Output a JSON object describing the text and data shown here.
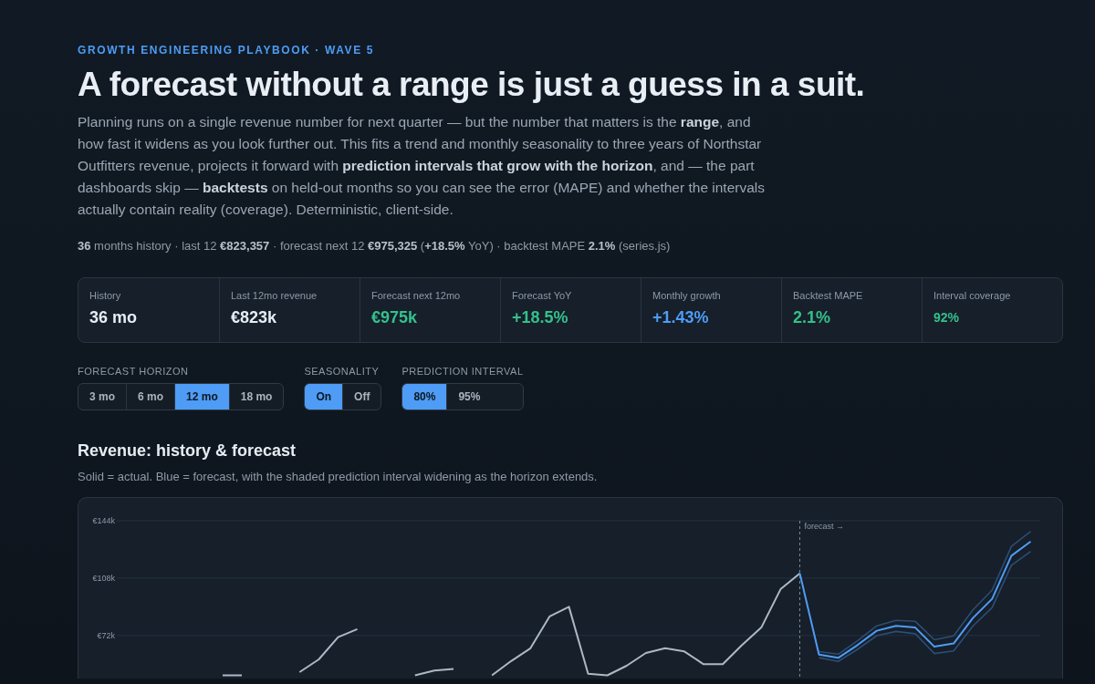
{
  "eyebrow": "GROWTH ENGINEERING PLAYBOOK · WAVE 5",
  "title": "A forecast without a range is just a guess in a suit.",
  "intro": "Planning runs on a single revenue number for next quarter — but the number that matters is the **range**, and how fast it widens as you look further out. This fits a trend and monthly seasonality to three years of Northstar Outfitters revenue, projects it forward with **prediction intervals that grow with the horizon**, and — the part dashboards skip — **backtests** on held-out months so you can see the error (MAPE) and whether the intervals actually contain reality (coverage). Deterministic, client-side.",
  "summary": "**36** months history · last 12 **€823,357** · forecast next 12 **€975,325** (**+18.5%** YoY) · backtest MAPE **2.1%** (series.js)",
  "stats": [
    {
      "label": "History",
      "value": "36 mo",
      "color": "#e6edf3",
      "kind": "large"
    },
    {
      "label": "Last 12mo revenue",
      "value": "€823k",
      "color": "#e6edf3",
      "kind": "large"
    },
    {
      "label": "Forecast next 12mo",
      "value": "€975k",
      "color": "#34c08b",
      "kind": "large"
    },
    {
      "label": "Forecast YoY",
      "value": "+18.5%",
      "color": "#34c08b",
      "kind": "large"
    },
    {
      "label": "Monthly growth",
      "value": "+1.43%",
      "color": "#4e9cf5",
      "kind": "large"
    },
    {
      "label": "Backtest MAPE",
      "value": "2.1%",
      "color": "#34c08b",
      "kind": "large"
    },
    {
      "label": "Interval coverage",
      "value": "92%",
      "color": "#34c08b",
      "kind": "small"
    }
  ],
  "controls": [
    {
      "label": "FORECAST HORIZON",
      "options": [
        {
          "label": "3 mo",
          "selected": false
        },
        {
          "label": "6 mo",
          "selected": false
        },
        {
          "label": "12 mo",
          "selected": true
        },
        {
          "label": "18 mo",
          "selected": false
        }
      ]
    },
    {
      "label": "SEASONALITY",
      "options": [
        {
          "label": "On",
          "selected": true
        },
        {
          "label": "Off",
          "selected": false
        }
      ]
    },
    {
      "label": "PREDICTION INTERVAL",
      "options": [
        {
          "label": "80%",
          "selected": true
        },
        {
          "label": "95%",
          "selected": false
        }
      ]
    }
  ],
  "chart": {
    "title": "Revenue: history & forecast",
    "subtitle": "Solid = actual. Blue = forecast, with the shaded prediction interval widening as the horizon extends.",
    "marker": "forecast →",
    "chart_data": {
      "type": "line",
      "ylim": [
        45,
        144
      ],
      "yticks": [
        {
          "value": 144,
          "label": "€144k"
        },
        {
          "value": 108,
          "label": "€108k"
        },
        {
          "value": 72,
          "label": "€72k"
        }
      ],
      "series": [
        {
          "color": "#aeb8c4",
          "values": [
            null,
            null,
            null,
            null,
            null,
            47,
            47,
            null,
            null,
            49,
            57,
            71,
            76,
            null,
            null,
            47,
            50,
            51,
            null,
            47,
            56,
            64,
            84,
            90,
            48,
            47,
            53,
            61,
            64,
            62,
            54,
            54,
            66,
            77,
            101,
            111,
            null,
            null,
            null,
            null,
            null,
            null,
            null,
            null,
            null,
            null,
            null,
            null
          ]
        },
        {
          "color": "#4e9cf5",
          "values": [
            null,
            null,
            null,
            null,
            null,
            null,
            null,
            null,
            null,
            null,
            null,
            null,
            null,
            null,
            null,
            null,
            null,
            null,
            null,
            null,
            null,
            null,
            null,
            null,
            null,
            null,
            null,
            null,
            null,
            null,
            null,
            null,
            null,
            null,
            null,
            111,
            60,
            58,
            66,
            75,
            78,
            77,
            65,
            67,
            83,
            95,
            122,
            131
          ]
        },
        {
          "color": "#2d4d74",
          "values": [
            null,
            null,
            null,
            null,
            null,
            null,
            null,
            null,
            null,
            null,
            null,
            null,
            null,
            null,
            null,
            null,
            null,
            null,
            null,
            null,
            null,
            null,
            null,
            null,
            null,
            null,
            null,
            null,
            null,
            null,
            null,
            null,
            null,
            null,
            null,
            null,
            61.9,
            60.3,
            68.7,
            78.1,
            81.5,
            80.9,
            69.3,
            71.7,
            88.1,
            100.5,
            127.9,
            137.3
          ]
        },
        {
          "color": "#2d4d74",
          "values": [
            null,
            null,
            null,
            null,
            null,
            null,
            null,
            null,
            null,
            null,
            null,
            null,
            null,
            null,
            null,
            null,
            null,
            null,
            null,
            null,
            null,
            null,
            null,
            null,
            null,
            null,
            null,
            null,
            null,
            null,
            null,
            null,
            null,
            null,
            null,
            null,
            58.1,
            55.7,
            63.3,
            71.9,
            74.5,
            73.1,
            60.7,
            62.3,
            77.9,
            89.5,
            116.1,
            124.7
          ]
        }
      ]
    }
  }
}
